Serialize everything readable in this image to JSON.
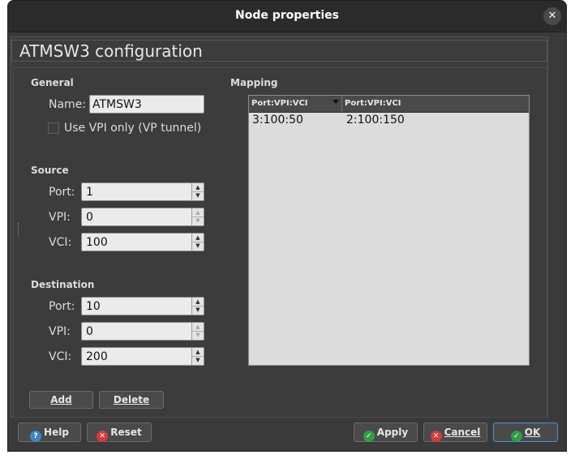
{
  "window": {
    "title": "Node properties"
  },
  "config_title": "ATMSW3 configuration",
  "general": {
    "label": "General",
    "name_label": "Name:",
    "name_value": "ATMSW3",
    "vpi_only_label": "Use VPI only (VP tunnel)",
    "vpi_only_checked": false
  },
  "source": {
    "label": "Source",
    "port_label": "Port:",
    "port_value": "1",
    "vpi_label": "VPI:",
    "vpi_value": "0",
    "vci_label": "VCI:",
    "vci_value": "100"
  },
  "destination": {
    "label": "Destination",
    "port_label": "Port:",
    "port_value": "10",
    "vpi_label": "VPI:",
    "vpi_value": "0",
    "vci_label": "VCI:",
    "vci_value": "200"
  },
  "mapping": {
    "label": "Mapping",
    "columns": [
      "Port:VPI:VCI",
      "Port:VPI:VCI"
    ],
    "rows": [
      [
        "3:100:50",
        "2:100:150"
      ]
    ]
  },
  "buttons": {
    "add": "Add",
    "delete": "Delete",
    "help": "Help",
    "reset": "Reset",
    "apply": "Apply",
    "cancel": "Cancel",
    "ok": "OK"
  },
  "colors": {
    "ok_accent": "#4a90d9",
    "apply_icon": "#2f9e44",
    "cancel_icon": "#d63a3a",
    "help_icon": "#3d85c6"
  }
}
